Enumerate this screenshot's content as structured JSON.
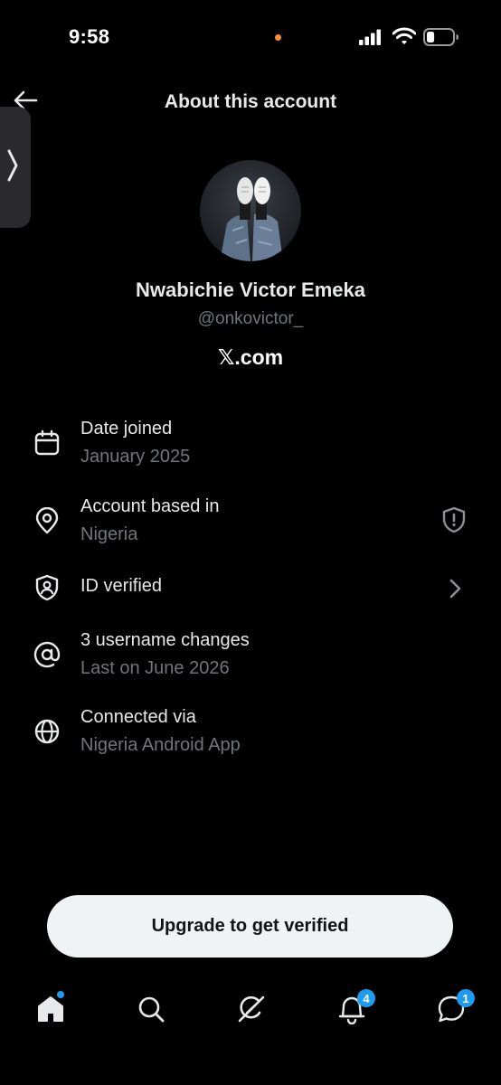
{
  "status_bar": {
    "time": "9:58",
    "dot_color": "#ff8c3a",
    "signal_icon": "cellular-signal-icon",
    "wifi_icon": "wifi-icon",
    "battery_icon": "battery-icon",
    "battery_level": 0.3
  },
  "header": {
    "title": "About this account",
    "back_icon": "arrow-left-icon",
    "side_tab_icon": "chevron-right-icon"
  },
  "profile": {
    "name": "Nwabichie Victor Emeka",
    "handle": "@onkovictor_",
    "platform": "𝕏.com"
  },
  "info": {
    "date_joined": {
      "title": "Date joined",
      "value": "January 2025",
      "icon": "calendar-icon"
    },
    "account_based": {
      "title": "Account based in",
      "value": "Nigeria",
      "icon": "location-pin-icon",
      "right_icon": "shield-alert-icon"
    },
    "id_verified": {
      "title": "ID verified",
      "icon": "id-shield-icon",
      "right_icon": "chevron-right-icon"
    },
    "username_changes": {
      "title": "3 username changes",
      "value": "Last on June 2026",
      "icon": "at-sign-icon"
    },
    "connected_via": {
      "title": "Connected via",
      "value": "Nigeria Android App",
      "icon": "globe-icon"
    }
  },
  "upgrade_button": {
    "label": "Upgrade to get verified"
  },
  "bottom_nav": {
    "home_icon": "home-icon",
    "search_icon": "search-icon",
    "grok_icon": "grok-icon",
    "notifications_icon": "bell-icon",
    "notifications_count": "4",
    "messages_icon": "chat-bubble-icon",
    "messages_count": "1",
    "badge_color": "#1d9bf0"
  }
}
